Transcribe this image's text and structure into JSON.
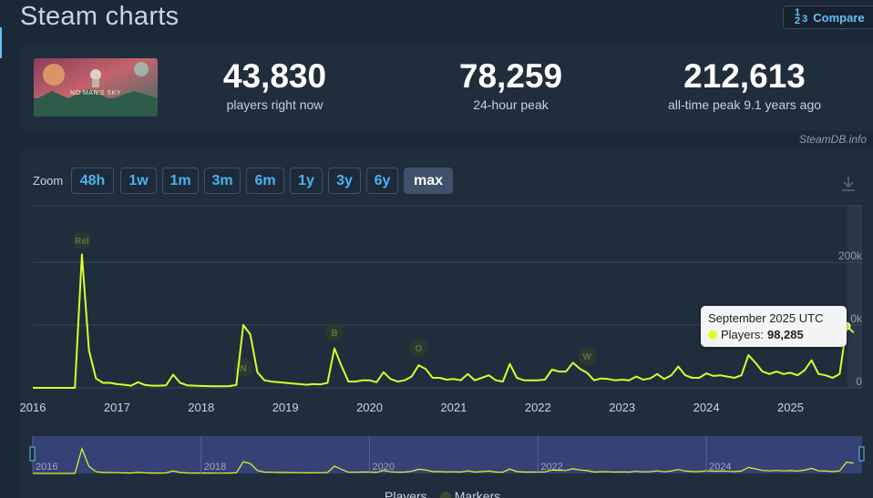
{
  "page": {
    "title": "Steam charts",
    "compare_label": "Compare",
    "compare_icon_top": "1",
    "compare_icon_bottom": "2",
    "compare_icon_side": "3"
  },
  "game": {
    "thumb_text": "NO MAN'S SKY"
  },
  "stats": [
    {
      "value": "43,830",
      "label": "players right now"
    },
    {
      "value": "78,259",
      "label": "24-hour peak"
    },
    {
      "value": "212,613",
      "label": "all-time peak 9.1 years ago"
    }
  ],
  "steamdb_label": "SteamDB.info",
  "zoom": {
    "label": "Zoom",
    "options": [
      "48h",
      "1w",
      "1m",
      "3m",
      "6m",
      "1y",
      "3y",
      "6y",
      "max"
    ],
    "selected": "max"
  },
  "tooltip": {
    "date": "September 2025 UTC",
    "series": "Players:",
    "value": "98,285"
  },
  "legend": {
    "players": "Players",
    "markers": "Markers"
  },
  "colors": {
    "line": "#d8ff2a",
    "accent": "#66c0f4",
    "background": "#1b2838",
    "card": "#202d3d"
  },
  "chart_data": {
    "type": "line",
    "title": "",
    "xlabel": "",
    "ylabel": "",
    "x_ticks": [
      "2016",
      "2017",
      "2018",
      "2019",
      "2020",
      "2021",
      "2022",
      "2023",
      "2024",
      "2025"
    ],
    "y_ticks": [
      "0",
      "100k",
      "200k"
    ],
    "y_tick_labels_visible": [
      "0",
      "0k",
      "200k"
    ],
    "ylim": [
      0,
      290000
    ],
    "grid": true,
    "markers": [
      {
        "label": "Rel",
        "date": "2016-08"
      },
      {
        "label": "N",
        "date": "2018-07"
      },
      {
        "label": "B",
        "date": "2019-08"
      },
      {
        "label": "O",
        "date": "2020-08"
      },
      {
        "label": "W",
        "date": "2022-08"
      }
    ],
    "series": [
      {
        "name": "Players",
        "points": [
          [
            "2016-01",
            0
          ],
          [
            "2016-07",
            0
          ],
          [
            "2016-08",
            212613
          ],
          [
            "2016-09",
            60000
          ],
          [
            "2016-10",
            15000
          ],
          [
            "2016-11",
            8000
          ],
          [
            "2016-12",
            8000
          ],
          [
            "2017-01",
            6000
          ],
          [
            "2017-02",
            5000
          ],
          [
            "2017-03",
            3500
          ],
          [
            "2017-04",
            9000
          ],
          [
            "2017-05",
            4500
          ],
          [
            "2017-06",
            3500
          ],
          [
            "2017-07",
            3500
          ],
          [
            "2017-08",
            4000
          ],
          [
            "2017-09",
            21000
          ],
          [
            "2017-10",
            8000
          ],
          [
            "2017-11",
            4000
          ],
          [
            "2017-12",
            3500
          ],
          [
            "2018-01",
            3000
          ],
          [
            "2018-02",
            2800
          ],
          [
            "2018-03",
            2600
          ],
          [
            "2018-04",
            2600
          ],
          [
            "2018-05",
            2800
          ],
          [
            "2018-06",
            4500
          ],
          [
            "2018-07",
            100000
          ],
          [
            "2018-08",
            85000
          ],
          [
            "2018-09",
            25000
          ],
          [
            "2018-10",
            12000
          ],
          [
            "2018-11",
            10000
          ],
          [
            "2018-12",
            9000
          ],
          [
            "2019-01",
            8000
          ],
          [
            "2019-02",
            7000
          ],
          [
            "2019-03",
            6000
          ],
          [
            "2019-04",
            5000
          ],
          [
            "2019-05",
            6000
          ],
          [
            "2019-06",
            5500
          ],
          [
            "2019-07",
            8000
          ],
          [
            "2019-08",
            63000
          ],
          [
            "2019-09",
            35000
          ],
          [
            "2019-10",
            10000
          ],
          [
            "2019-11",
            10000
          ],
          [
            "2019-12",
            12000
          ],
          [
            "2020-01",
            12000
          ],
          [
            "2020-02",
            9000
          ],
          [
            "2020-03",
            25000
          ],
          [
            "2020-04",
            14000
          ],
          [
            "2020-05",
            10000
          ],
          [
            "2020-06",
            12000
          ],
          [
            "2020-07",
            18000
          ],
          [
            "2020-08",
            36000
          ],
          [
            "2020-09",
            30000
          ],
          [
            "2020-10",
            16000
          ],
          [
            "2020-11",
            16000
          ],
          [
            "2020-12",
            13000
          ],
          [
            "2021-01",
            14000
          ],
          [
            "2021-02",
            12000
          ],
          [
            "2021-03",
            22000
          ],
          [
            "2021-04",
            12000
          ],
          [
            "2021-05",
            16000
          ],
          [
            "2021-06",
            20000
          ],
          [
            "2021-07",
            12000
          ],
          [
            "2021-08",
            10000
          ],
          [
            "2021-09",
            38000
          ],
          [
            "2021-10",
            16000
          ],
          [
            "2021-11",
            12000
          ],
          [
            "2021-12",
            12000
          ],
          [
            "2022-01",
            12000
          ],
          [
            "2022-02",
            13000
          ],
          [
            "2022-03",
            29000
          ],
          [
            "2022-04",
            26000
          ],
          [
            "2022-05",
            26000
          ],
          [
            "2022-06",
            40000
          ],
          [
            "2022-07",
            30000
          ],
          [
            "2022-08",
            24000
          ],
          [
            "2022-09",
            12000
          ],
          [
            "2022-10",
            15000
          ],
          [
            "2022-11",
            14000
          ],
          [
            "2022-12",
            12000
          ],
          [
            "2023-01",
            13000
          ],
          [
            "2023-02",
            12000
          ],
          [
            "2023-03",
            18000
          ],
          [
            "2023-04",
            13000
          ],
          [
            "2023-05",
            15000
          ],
          [
            "2023-06",
            22000
          ],
          [
            "2023-07",
            14000
          ],
          [
            "2023-08",
            20000
          ],
          [
            "2023-09",
            34000
          ],
          [
            "2023-10",
            20000
          ],
          [
            "2023-11",
            16000
          ],
          [
            "2023-12",
            16000
          ],
          [
            "2024-01",
            23000
          ],
          [
            "2024-02",
            19000
          ],
          [
            "2024-03",
            20000
          ],
          [
            "2024-04",
            18000
          ],
          [
            "2024-05",
            16000
          ],
          [
            "2024-06",
            20000
          ],
          [
            "2024-07",
            52000
          ],
          [
            "2024-08",
            40000
          ],
          [
            "2024-09",
            26000
          ],
          [
            "2024-10",
            22000
          ],
          [
            "2024-11",
            26000
          ],
          [
            "2024-12",
            22000
          ],
          [
            "2025-01",
            24000
          ],
          [
            "2025-02",
            20000
          ],
          [
            "2025-03",
            28000
          ],
          [
            "2025-04",
            44000
          ],
          [
            "2025-05",
            22000
          ],
          [
            "2025-06",
            20000
          ],
          [
            "2025-07",
            16000
          ],
          [
            "2025-08",
            22000
          ],
          [
            "2025-09",
            98285
          ],
          [
            "2025-10",
            88000
          ]
        ]
      }
    ]
  }
}
